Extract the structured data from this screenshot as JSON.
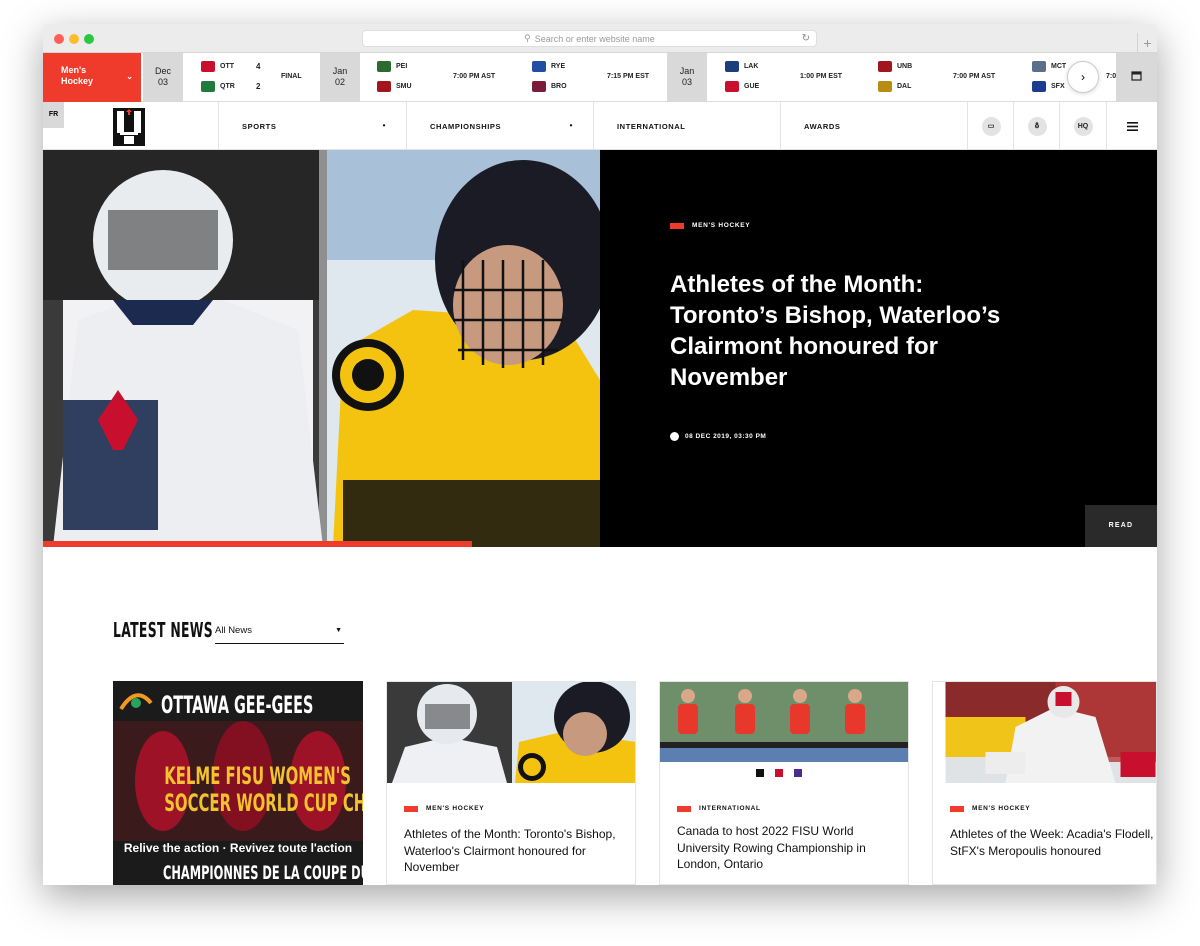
{
  "browser": {
    "url_placeholder": "Search or enter website name"
  },
  "scoreboard": {
    "sport": {
      "line1": "Men's",
      "line2": "Hockey"
    },
    "dates": [
      {
        "month": "Dec",
        "day": "03"
      },
      {
        "month": "Jan",
        "day": "02"
      },
      {
        "month": "Jan",
        "day": "03"
      }
    ],
    "games": [
      {
        "team1": "OTT",
        "team2": "QTR",
        "score1": "4",
        "score2": "2",
        "status": "FINAL",
        "c1": "#c8102e",
        "c2": "#1f7a3b"
      },
      {
        "team1": "PEI",
        "team2": "SMU",
        "status": "7:00 PM AST",
        "c1": "#2d6a2f",
        "c2": "#a3151c"
      },
      {
        "team1": "RYE",
        "team2": "BRO",
        "status": "7:15 PM EST",
        "c1": "#1f4ea3",
        "c2": "#7b1d3a"
      },
      {
        "team1": "LAK",
        "team2": "GUE",
        "status": "1:00 PM EST",
        "c1": "#1b3f7a",
        "c2": "#c8102e"
      },
      {
        "team1": "UNB",
        "team2": "DAL",
        "status": "7:00 PM AST",
        "c1": "#a3151c",
        "c2": "#b88b12"
      },
      {
        "team1": "MCT",
        "team2": "SFX",
        "status": "7:0",
        "c1": "#5c6f8a",
        "c2": "#1c3d8f"
      }
    ]
  },
  "nav": {
    "lang": "FR",
    "items": [
      "SPORTS",
      "CHAMPIONSHIPS",
      "INTERNATIONAL",
      "AWARDS"
    ],
    "hq": "HQ"
  },
  "hero": {
    "tag": "MEN'S HOCKEY",
    "title": "Athletes of the Month: Toronto’s Bishop, Waterloo’s Clairmont honoured for November",
    "date": "08 DEC 2019, 03:30 PM",
    "read": "READ",
    "progress": 0.77
  },
  "latest": {
    "heading": "LATEST NEWS",
    "filter": "All News",
    "promo": {
      "top": "OTTAWA GEE-GEES",
      "main": [
        "KELME FISU WOMEN'S",
        "SOCCER WORLD CUP CHAMPS"
      ],
      "sub": "Relive the action · Revivez toute l'action",
      "bottom": "CHAMPIONNES DE LA COUPE DU MONDE"
    },
    "cards": [
      {
        "tag": "MEN'S HOCKEY",
        "title": "Athletes of the Month: Toronto's Bishop, Waterloo's Clairmont honoured for November"
      },
      {
        "tag": "INTERNATIONAL",
        "title": "Canada to host 2022 FISU World University Rowing Championship in London, Ontario"
      },
      {
        "tag": "MEN'S HOCKEY",
        "title": "Athletes of the Week: Acadia's Flodell, StFX's Meropoulis honoured"
      }
    ]
  }
}
